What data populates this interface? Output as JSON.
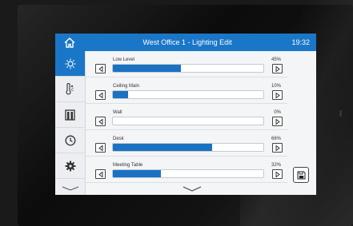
{
  "header": {
    "title": "West Office 1 - Lighting Edit",
    "clock": "19:32"
  },
  "sidebar": {
    "items": [
      {
        "icon": "lightbulb-icon",
        "active": true
      },
      {
        "icon": "thermometer-icon",
        "active": false
      },
      {
        "icon": "blinds-icon",
        "active": false
      },
      {
        "icon": "clock-icon",
        "active": false
      },
      {
        "icon": "gear-icon",
        "active": false
      }
    ],
    "more_icon": "chevron-down-icon"
  },
  "lights": [
    {
      "label": "Low Level",
      "percent_text": "45%",
      "level": 45
    },
    {
      "label": "Ceiling Main",
      "percent_text": "10%",
      "level": 10
    },
    {
      "label": "Wall",
      "percent_text": "0%",
      "level": 0
    },
    {
      "label": "Desk",
      "percent_text": "66%",
      "level": 66
    },
    {
      "label": "Meeting Table",
      "percent_text": "32%",
      "level": 32
    }
  ],
  "colors": {
    "accent": "#1a76c7",
    "bar_fill": "#1a72c2"
  },
  "actions": {
    "save_icon": "save-icon",
    "more_icon": "chevron-down-icon"
  }
}
